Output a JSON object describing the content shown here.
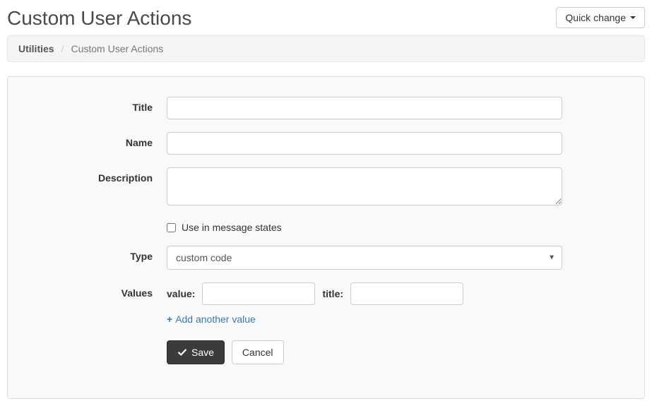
{
  "header": {
    "title": "Custom User Actions",
    "quick_change_label": "Quick change"
  },
  "breadcrumb": {
    "parent": "Utilities",
    "current": "Custom User Actions"
  },
  "form": {
    "title_label": "Title",
    "title_value": "",
    "name_label": "Name",
    "name_value": "",
    "description_label": "Description",
    "description_value": "",
    "use_in_message_states_label": "Use in message states",
    "use_in_message_states_checked": false,
    "type_label": "Type",
    "type_selected": "custom code",
    "values_label": "Values",
    "value_sublabel": "value:",
    "value_input": "",
    "title_sublabel": "title:",
    "title_input": "",
    "add_another_label": "Add another value",
    "save_label": "Save",
    "cancel_label": "Cancel"
  }
}
